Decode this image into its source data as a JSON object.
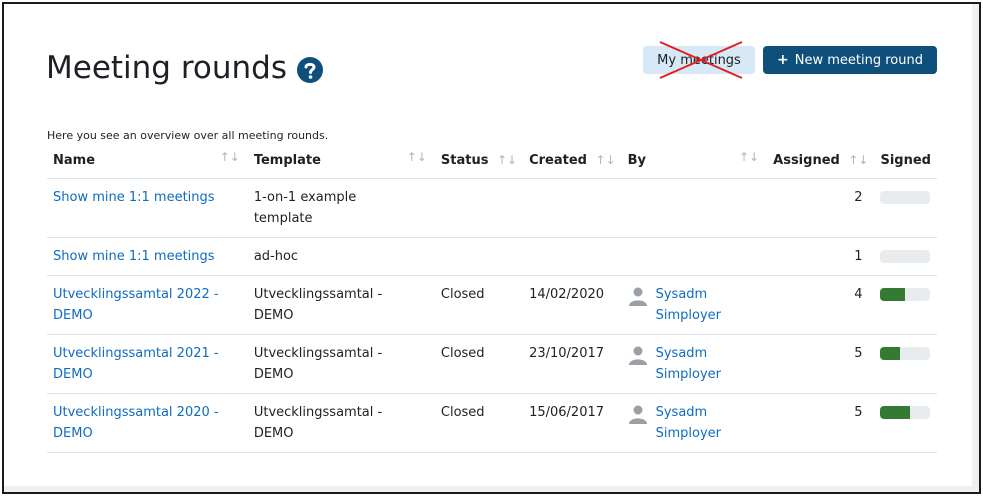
{
  "page": {
    "title": "Meeting rounds",
    "intro": "Here you see an overview over all meeting rounds."
  },
  "icons": {
    "help": "question-circle-icon",
    "sort": "sort-arrows-icon",
    "user": "user-avatar-icon",
    "plus": "plus-icon"
  },
  "colors": {
    "primary": "#0f4f7c",
    "link": "#0f6cbf",
    "secondary_button_bg": "#d7e9f7",
    "progress_fill": "#357a32",
    "cross_mark": "#e02020"
  },
  "toolbar": {
    "my_meetings_label": "My meetings",
    "new_round_plus": "+",
    "new_round_label": "New meeting round"
  },
  "table": {
    "headers": {
      "name": "Name",
      "template": "Template",
      "status": "Status",
      "created": "Created",
      "by": "By",
      "assigned": "Assigned",
      "signed": "Signed"
    },
    "sort_glyph": "↑↓",
    "rows": [
      {
        "name_line1": "Show mine 1:1 meetings",
        "name_line2": "",
        "template_line1": "1-on-1 example",
        "template_line2": "template",
        "status": "",
        "created": "",
        "by_first": "",
        "by_last": "",
        "assigned": "2",
        "signed_fraction": 0
      },
      {
        "name_line1": "Show mine 1:1 meetings",
        "name_line2": "",
        "template_line1": "ad-hoc",
        "template_line2": "",
        "status": "",
        "created": "",
        "by_first": "",
        "by_last": "",
        "assigned": "1",
        "signed_fraction": 0
      },
      {
        "name_line1": "Utvecklingssamtal 2022 -",
        "name_line2": "DEMO",
        "template_line1": "Utvecklingssamtal -",
        "template_line2": "DEMO",
        "status": "Closed",
        "created": "14/02/2020",
        "by_first": "Sysadm",
        "by_last": "Simployer",
        "assigned": "4",
        "signed_fraction": 0.5
      },
      {
        "name_line1": "Utvecklingssamtal 2021 -",
        "name_line2": "DEMO",
        "template_line1": "Utvecklingssamtal -",
        "template_line2": "DEMO",
        "status": "Closed",
        "created": "23/10/2017",
        "by_first": "Sysadm",
        "by_last": "Simployer",
        "assigned": "5",
        "signed_fraction": 0.4
      },
      {
        "name_line1": "Utvecklingssamtal 2020 -",
        "name_line2": "DEMO",
        "template_line1": "Utvecklingssamtal -",
        "template_line2": "DEMO",
        "status": "Closed",
        "created": "15/06/2017",
        "by_first": "Sysadm",
        "by_last": "Simployer",
        "assigned": "5",
        "signed_fraction": 0.6
      }
    ]
  }
}
